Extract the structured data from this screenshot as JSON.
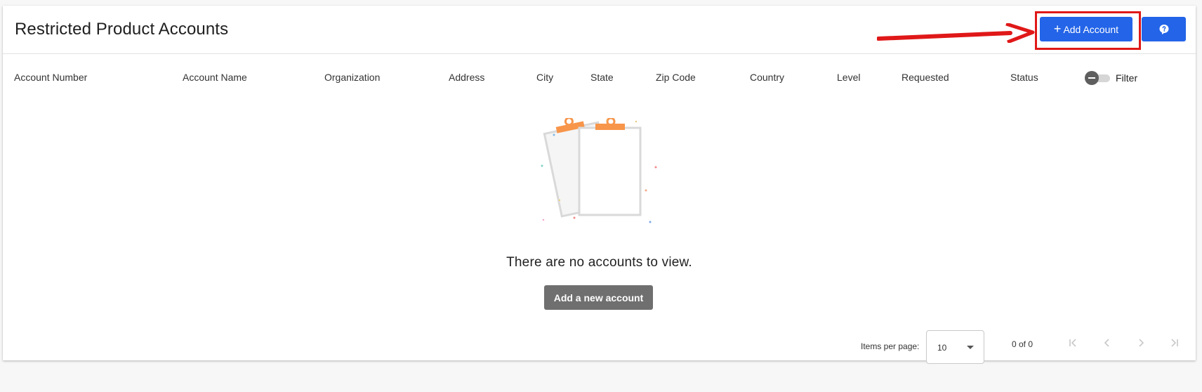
{
  "header": {
    "title": "Restricted Product Accounts",
    "add_button_label": "Add Account",
    "add_button_icon": "plus-icon",
    "help_button_icon": "help-icon"
  },
  "table": {
    "columns": [
      "Account Number",
      "Account Name",
      "Organization",
      "Address",
      "City",
      "State",
      "Zip Code",
      "Country",
      "Level",
      "Requested",
      "Status"
    ],
    "filter_label": "Filter",
    "filter_enabled": false
  },
  "empty_state": {
    "message": "There are no accounts to view.",
    "button_label": "Add a new account",
    "illustration_icon": "empty-clipboard-icon"
  },
  "pagination": {
    "items_per_page_label": "Items per page:",
    "items_per_page_value": "10",
    "range_label": "0 of 0"
  },
  "colors": {
    "primary": "#2364e8",
    "highlight": "#e01818",
    "secondary_button": "#6f6f6f",
    "illustration_accent": "#f7954a"
  }
}
